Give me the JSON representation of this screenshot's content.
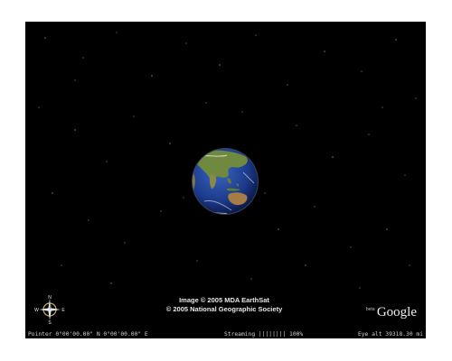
{
  "credits": {
    "line1": "Image © 2005 MDA EarthSat",
    "line2": "© 2005 National Geographic Society"
  },
  "compass": {
    "north": "N",
    "south": "S",
    "east": "E",
    "west": "W"
  },
  "brand": {
    "name": "Google",
    "beta": "beta"
  },
  "statusbar": {
    "pointer": "Pointer  0°00'00.00\"  N   0°00'00.00\"  E",
    "streaming": "Streaming |||||||| 100%",
    "eye_alt": "Eye  alt  39318.30 mi"
  },
  "colors": {
    "space": "#000000",
    "ocean": "#1f3f8f",
    "land": "#6e8a3c",
    "text": "#e6e6e6"
  },
  "icons": {
    "compass": "compass-rose-icon"
  }
}
